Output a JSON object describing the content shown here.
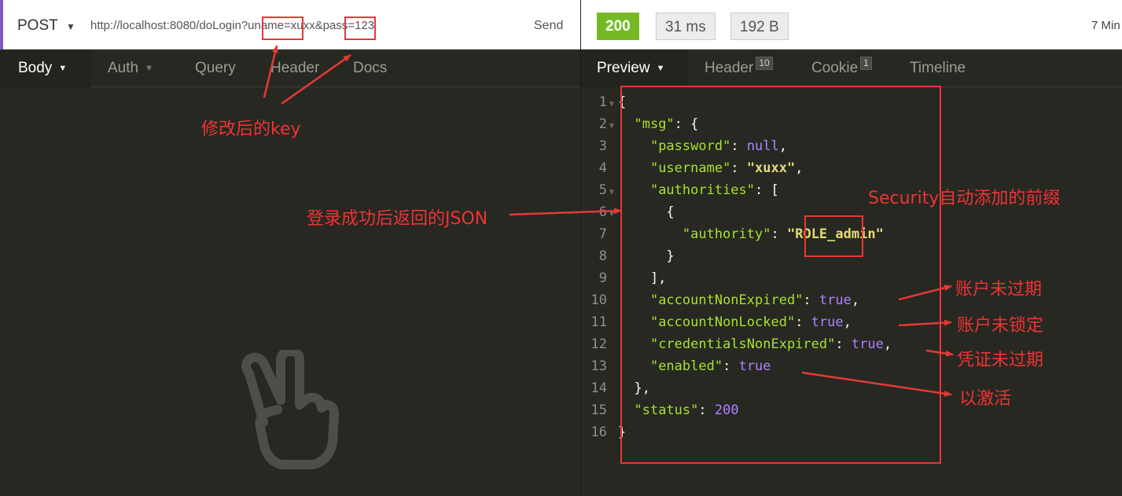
{
  "request": {
    "method": "POST",
    "url": "http://localhost:8080/doLogin?uname=xuxx&pass=123",
    "send_label": "Send"
  },
  "response": {
    "status": "200",
    "time": "31 ms",
    "size": "192 B",
    "age": "7 Min"
  },
  "request_tabs": [
    {
      "label": "Body",
      "active": true
    },
    {
      "label": "Auth",
      "active": false
    },
    {
      "label": "Query",
      "active": false
    },
    {
      "label": "Header",
      "active": false
    },
    {
      "label": "Docs",
      "active": false
    }
  ],
  "response_tabs": [
    {
      "label": "Preview",
      "active": true
    },
    {
      "label": "Header",
      "badge": "10",
      "active": false
    },
    {
      "label": "Cookie",
      "badge": "1",
      "active": false
    },
    {
      "label": "Timeline",
      "active": false
    }
  ],
  "code_lines": [
    "{",
    "  \"msg\": {",
    "    \"password\": null,",
    "    \"username\": \"xuxx\",",
    "    \"authorities\": [",
    "      {",
    "        \"authority\": \"ROLE_admin\"",
    "      }",
    "    ],",
    "    \"accountNonExpired\": true,",
    "    \"accountNonLocked\": true,",
    "    \"credentialsNonExpired\": true,",
    "    \"enabled\": true",
    "  },",
    "  \"status\": 200",
    "}"
  ],
  "annotations": {
    "modified_key": "修改后的key",
    "login_json": "登录成功后返回的JSON",
    "security_prefix": "Security自动添加的前缀",
    "account_not_expired": "账户未过期",
    "account_not_locked": "账户未锁定",
    "credentials_not_expired": "凭证未过期",
    "enabled": "以激活"
  },
  "icons": {
    "method_dropdown": "caret-down-icon",
    "empty_body": "peace-hand-icon"
  },
  "colors": {
    "status_ok": "#75ba24",
    "accent": "#7c5cbf",
    "annotation": "#e53935",
    "json_key": "#a6e22e",
    "json_string": "#e6db74",
    "json_literal": "#ae81ff"
  }
}
